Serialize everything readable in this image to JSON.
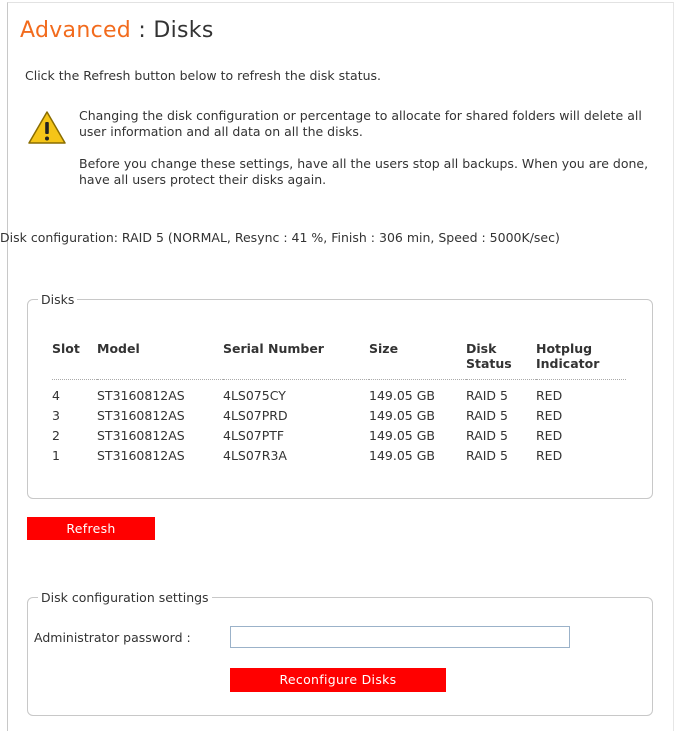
{
  "page": {
    "title_section": "Advanced",
    "title_separator": " : ",
    "title_page": "Disks",
    "intro": "Click the Refresh button below to refresh the disk status.",
    "warning_line1": "Changing the disk configuration or percentage to allocate for shared folders will delete all user information and all data on all the disks.",
    "warning_line2": "Before you change these settings, have all the users stop all backups. When you are done, have all users protect their disks again.",
    "disk_configuration": "Disk configuration: RAID 5 (NORMAL, Resync : 41 %, Finish : 306 min, Speed : 5000K/sec)"
  },
  "disks_panel": {
    "legend": "Disks",
    "columns": {
      "slot": "Slot",
      "model": "Model",
      "serial": "Serial Number",
      "size": "Size",
      "status": "Disk Status",
      "hotplug": "Hotplug Indicator"
    },
    "rows": [
      {
        "slot": "4",
        "model": "ST3160812AS",
        "serial": "4LS075CY",
        "size": "149.05 GB",
        "status": "RAID 5",
        "hotplug": "RED"
      },
      {
        "slot": "3",
        "model": "ST3160812AS",
        "serial": "4LS07PRD",
        "size": "149.05 GB",
        "status": "RAID 5",
        "hotplug": "RED"
      },
      {
        "slot": "2",
        "model": "ST3160812AS",
        "serial": "4LS07PTF",
        "size": "149.05 GB",
        "status": "RAID 5",
        "hotplug": "RED"
      },
      {
        "slot": "1",
        "model": "ST3160812AS",
        "serial": "4LS07R3A",
        "size": "149.05 GB",
        "status": "RAID 5",
        "hotplug": "RED"
      }
    ]
  },
  "refresh_button": {
    "label": "Refresh"
  },
  "config_panel": {
    "legend": "Disk configuration settings",
    "password_label": "Administrator password :",
    "password_value": "",
    "reconfigure_label": "Reconfigure Disks"
  },
  "icons": {
    "warning": "warning-icon"
  },
  "colors": {
    "title_accent": "#f26b1d",
    "button_bg": "#ff0000",
    "button_text": "#ffffff",
    "warning_fill": "#f5c518"
  }
}
